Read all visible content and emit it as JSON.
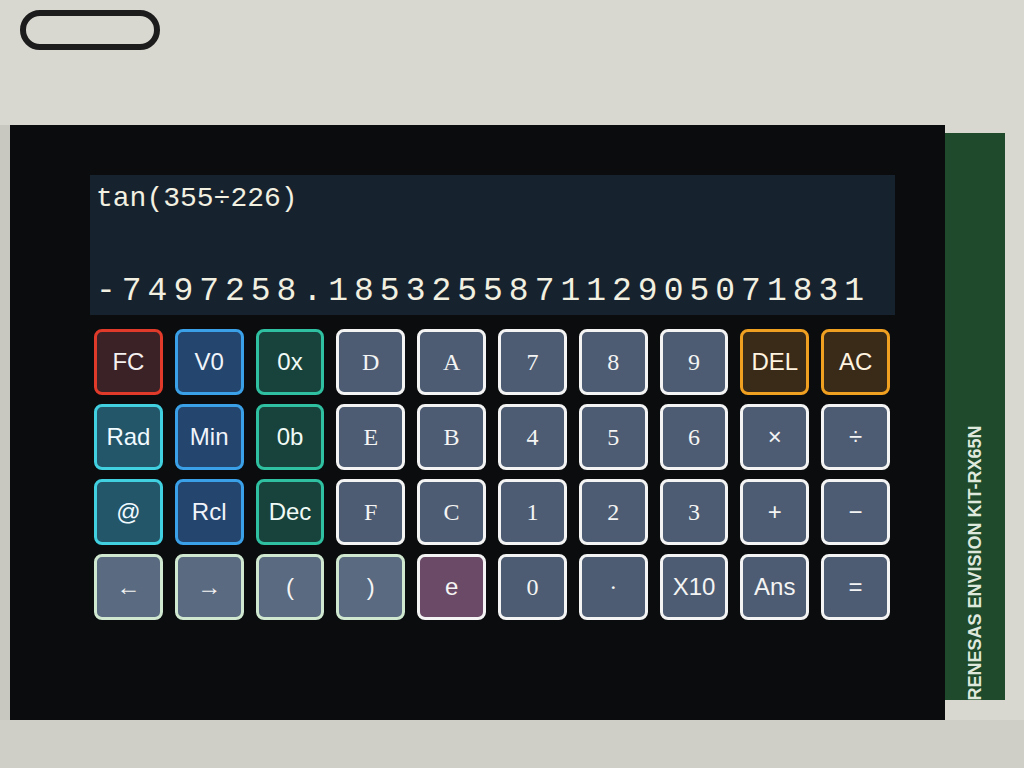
{
  "display": {
    "expression": "tan(355÷226)",
    "result": "-7497258.185325587112905071831"
  },
  "keys": {
    "rows": [
      [
        {
          "label": "FC",
          "kind": "func"
        },
        {
          "label": "V0",
          "kind": "mem"
        },
        {
          "label": "0x",
          "kind": "base"
        },
        {
          "label": "D",
          "kind": "hex"
        },
        {
          "label": "A",
          "kind": "hex"
        },
        {
          "label": "7",
          "kind": "num"
        },
        {
          "label": "8",
          "kind": "num"
        },
        {
          "label": "9",
          "kind": "num"
        },
        {
          "label": "DEL",
          "kind": "clear"
        },
        {
          "label": "AC",
          "kind": "clear"
        }
      ],
      [
        {
          "label": "Rad",
          "kind": "mode"
        },
        {
          "label": "Min",
          "kind": "mem"
        },
        {
          "label": "0b",
          "kind": "base"
        },
        {
          "label": "E",
          "kind": "hex"
        },
        {
          "label": "B",
          "kind": "hex"
        },
        {
          "label": "4",
          "kind": "num"
        },
        {
          "label": "5",
          "kind": "num"
        },
        {
          "label": "6",
          "kind": "num"
        },
        {
          "label": "×",
          "kind": "op"
        },
        {
          "label": "÷",
          "kind": "op"
        }
      ],
      [
        {
          "label": "@",
          "kind": "mode"
        },
        {
          "label": "Rcl",
          "kind": "mem"
        },
        {
          "label": "Dec",
          "kind": "base"
        },
        {
          "label": "F",
          "kind": "hex"
        },
        {
          "label": "C",
          "kind": "hex"
        },
        {
          "label": "1",
          "kind": "num"
        },
        {
          "label": "2",
          "kind": "num"
        },
        {
          "label": "3",
          "kind": "num"
        },
        {
          "label": "+",
          "kind": "op"
        },
        {
          "label": "−",
          "kind": "op"
        }
      ],
      [
        {
          "label": "←",
          "kind": "nav"
        },
        {
          "label": "→",
          "kind": "nav"
        },
        {
          "label": "(",
          "kind": "nav"
        },
        {
          "label": ")",
          "kind": "nav"
        },
        {
          "label": "e",
          "kind": "exp"
        },
        {
          "label": "0",
          "kind": "num"
        },
        {
          "label": "·",
          "kind": "num"
        },
        {
          "label": "X10",
          "kind": "op"
        },
        {
          "label": "Ans",
          "kind": "op"
        },
        {
          "label": "=",
          "kind": "op"
        }
      ]
    ]
  },
  "board": {
    "label": "RENESAS ENVISION KIT-RX65N"
  }
}
